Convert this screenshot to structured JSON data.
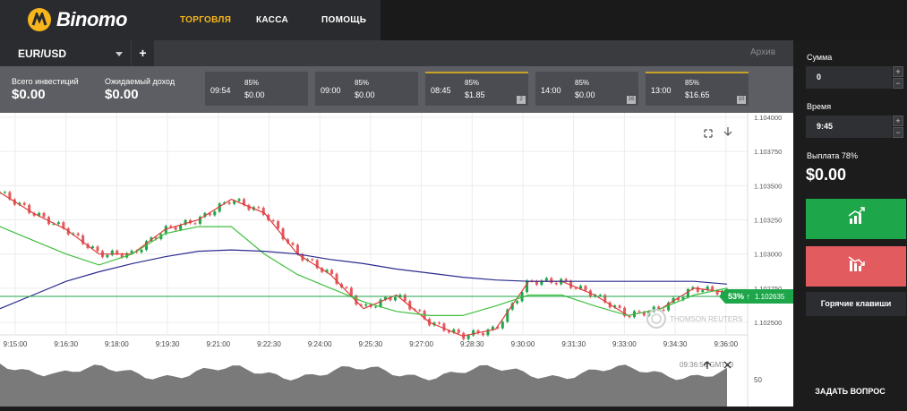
{
  "brand": {
    "name": "Binomo",
    "accent": "#f6b61c"
  },
  "nav": [
    {
      "label": "ТОРГОВЛЯ",
      "active": true
    },
    {
      "label": "КАССА",
      "active": false
    },
    {
      "label": "ПОМОЩЬ",
      "active": false
    }
  ],
  "tabs": {
    "pair": "EUR/USD",
    "add": "+",
    "archive": "Архив"
  },
  "summary": {
    "total_label": "Всего инвестиций",
    "total_value": "$0.00",
    "expected_label": "Ожидаемый доход",
    "expected_value": "$0.00"
  },
  "deals": [
    {
      "time": "09:54",
      "pct": "85%",
      "amount": "$0.00",
      "badge": "",
      "highlight": false
    },
    {
      "time": "09:00",
      "pct": "85%",
      "amount": "$0.00",
      "badge": "",
      "highlight": false
    },
    {
      "time": "08:45",
      "pct": "85%",
      "amount": "$1.85",
      "badge": "2",
      "highlight": true
    },
    {
      "time": "14:00",
      "pct": "85%",
      "amount": "$0.00",
      "badge": "16",
      "highlight": false
    },
    {
      "time": "13:00",
      "pct": "85%",
      "amount": "$16.65",
      "badge": "10",
      "highlight": true
    }
  ],
  "sidebar": {
    "amount_label": "Сумма",
    "amount_value": "0",
    "time_label": "Время",
    "time_value": "9:45",
    "payout_label": "Выплата 78%",
    "payout_value": "$0.00",
    "hotkeys": "Горячие клавиши",
    "ask": "ЗАДАТЬ ВОПРОС",
    "plus": "+",
    "minus": "−"
  },
  "chart": {
    "price_badge": "1.102635",
    "pct_badge": "53% ↑",
    "watermark": "THOMSON REUTERS",
    "osc_time": "09:36:56 GMT+3",
    "osc_level": "50",
    "colors": {
      "up": "#1ea64a",
      "down": "#e25b5e",
      "slow_ma": "#2b2b8f",
      "fast_ma": "#e03a3a",
      "mid_ma": "#3fbf3f"
    }
  },
  "chart_data": {
    "type": "line",
    "y_ticks": [
      "1.104000",
      "1.103750",
      "1.103500",
      "1.103250",
      "1.103000",
      "1.102750",
      "1.102500"
    ],
    "x_ticks": [
      "9:15:00",
      "9:16:30",
      "9:18:00",
      "9:19:30",
      "9:21:00",
      "9:22:30",
      "9:24:00",
      "9:25:30",
      "9:27:00",
      "9:28:30",
      "9:30:00",
      "9:31:30",
      "9:33:00",
      "9:34:30",
      "9:36:00"
    ],
    "ylim": [
      1.1025,
      1.104
    ],
    "current_price": 1.102635,
    "series": [
      {
        "values": [
          1.10345,
          1.1033,
          1.10318,
          1.103,
          1.103,
          1.10318,
          1.10325,
          1.1034,
          1.1033,
          1.103,
          1.10285,
          1.1026,
          1.1027,
          1.1025,
          1.1024,
          1.10245,
          1.1028,
          1.1028,
          1.1027,
          1.10255,
          1.1026,
          1.10275,
          1.10272
        ]
      },
      {
        "values": [
          1.1032,
          1.1031,
          1.103,
          1.10292,
          1.103,
          1.10315,
          1.1032,
          1.1032,
          1.103,
          1.10285,
          1.10275,
          1.10265,
          1.10258,
          1.10255,
          1.10255,
          1.10262,
          1.1027,
          1.1027,
          1.10262,
          1.10255,
          1.1026,
          1.1027,
          1.10275
        ]
      },
      {
        "values": [
          1.1026,
          1.1027,
          1.1028,
          1.10287,
          1.10293,
          1.10298,
          1.10302,
          1.10303,
          1.10302,
          1.103,
          1.10296,
          1.10293,
          1.10289,
          1.10286,
          1.10283,
          1.10281,
          1.1028,
          1.1028,
          1.1028,
          1.1028,
          1.1028,
          1.1028,
          1.10278
        ]
      }
    ]
  }
}
